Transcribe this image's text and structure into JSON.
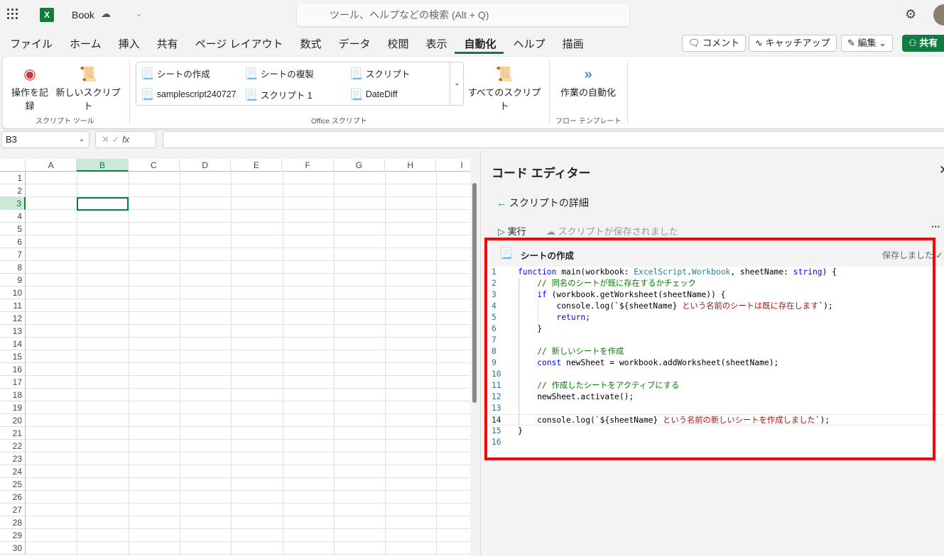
{
  "titlebar": {
    "app_icon": "excel-icon",
    "title": "Book",
    "search_placeholder": "ツール、ヘルプなどの検索 (Alt + Q)"
  },
  "menu": [
    "ファイル",
    "ホーム",
    "挿入",
    "共有",
    "ページ レイアウト",
    "数式",
    "データ",
    "校閲",
    "表示",
    "自動化",
    "ヘルプ",
    "描画"
  ],
  "menu_active": "自動化",
  "top_buttons": {
    "comment": "コメント",
    "catchup": "キャッチアップ",
    "edit": "編集",
    "share": "共有"
  },
  "ribbon": {
    "record": "操作を記録",
    "new_script": "新しいスクリプト",
    "group1": "スクリプト ツール",
    "scripts": [
      "シートの作成",
      "シートの複製",
      "スクリプト",
      "samplescript240727",
      "スクリプト 1",
      "DateDiff"
    ],
    "all_scripts": "すべてのスクリプト",
    "group2": "Office スクリプト",
    "automate": "作業の自動化",
    "group3": "フロー テンプレート"
  },
  "formula_bar": {
    "name_box": "B3",
    "fx": "fx",
    "value": ""
  },
  "sheet": {
    "columns": [
      "A",
      "B",
      "C",
      "D",
      "E",
      "F",
      "G",
      "H",
      "I"
    ],
    "selected_cell": "B3",
    "rows": 30
  },
  "code_editor": {
    "title": "コード エディター",
    "back_label": "スクリプトの詳細",
    "run": "実行",
    "save_status": "スクリプトが保存されました",
    "script_name": "シートの作成",
    "saved": "保存しました",
    "lines": [
      [
        [
          "kw",
          "function "
        ],
        [
          "tx",
          "main(workbook: "
        ],
        [
          "ty",
          "ExcelScript"
        ],
        [
          "tx",
          "."
        ],
        [
          "ty",
          "Workbook"
        ],
        [
          "tx",
          ", sheetName: "
        ],
        [
          "kw",
          "string"
        ],
        [
          "tx",
          ") {"
        ]
      ],
      [
        [
          "tx",
          "    "
        ],
        [
          "cm",
          "// 同名のシートが既に存在するかチェック"
        ]
      ],
      [
        [
          "tx",
          "    "
        ],
        [
          "kw",
          "if"
        ],
        [
          "tx",
          " (workbook.getWorksheet(sheetName)) {"
        ]
      ],
      [
        [
          "tx",
          "        console.log(`${sheetName}"
        ],
        [
          "st",
          " という名前のシートは既に存在します"
        ],
        [
          "tx",
          "`);"
        ]
      ],
      [
        [
          "tx",
          "        "
        ],
        [
          "kw",
          "return"
        ],
        [
          "tx",
          ";"
        ]
      ],
      [
        [
          "tx",
          "    }"
        ]
      ],
      [],
      [
        [
          "tx",
          "    "
        ],
        [
          "cm",
          "// 新しいシートを作成"
        ]
      ],
      [
        [
          "tx",
          "    "
        ],
        [
          "kw",
          "const"
        ],
        [
          "tx",
          " newSheet = workbook.addWorksheet(sheetName);"
        ]
      ],
      [],
      [
        [
          "tx",
          "    "
        ],
        [
          "cm",
          "// 作成したシートをアクティブにする"
        ]
      ],
      [
        [
          "tx",
          "    newSheet.activate();"
        ]
      ],
      [],
      [
        [
          "tx",
          "    console.log(`${sheetName}"
        ],
        [
          "st",
          " という名前の新しいシートを作成しました"
        ],
        [
          "tx",
          "`);"
        ]
      ],
      [
        [
          "tx",
          "}"
        ]
      ],
      []
    ]
  }
}
